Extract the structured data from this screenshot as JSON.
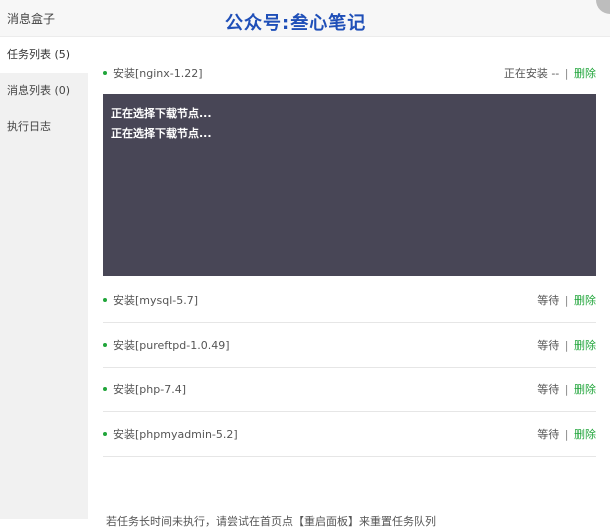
{
  "header": {
    "title": "消息盒子",
    "watermark": "公众号:叁心笔记"
  },
  "sidebar": {
    "items": [
      {
        "label": "任务列表 (5)"
      },
      {
        "label": "消息列表 (0)"
      },
      {
        "label": "执行日志"
      }
    ]
  },
  "tasks": [
    {
      "name": "安装[nginx-1.22]",
      "status": "正在安装 --",
      "action": "删除"
    },
    {
      "name": "安装[mysql-5.7]",
      "status": "等待",
      "action": "删除"
    },
    {
      "name": "安装[pureftpd-1.0.49]",
      "status": "等待",
      "action": "删除"
    },
    {
      "name": "安装[php-7.4]",
      "status": "等待",
      "action": "删除"
    },
    {
      "name": "安装[phpmyadmin-5.2]",
      "status": "等待",
      "action": "删除"
    }
  ],
  "console": {
    "lines": [
      "正在选择下载节点...",
      "正在选择下载节点..."
    ]
  },
  "footer": {
    "tip": "若任务长时间未执行，请尝试在首页点【重启面板】来重置任务队列"
  },
  "colors": {
    "accent": "#20a53a",
    "console_bg": "#484656",
    "watermark": "#1f4fb8"
  }
}
